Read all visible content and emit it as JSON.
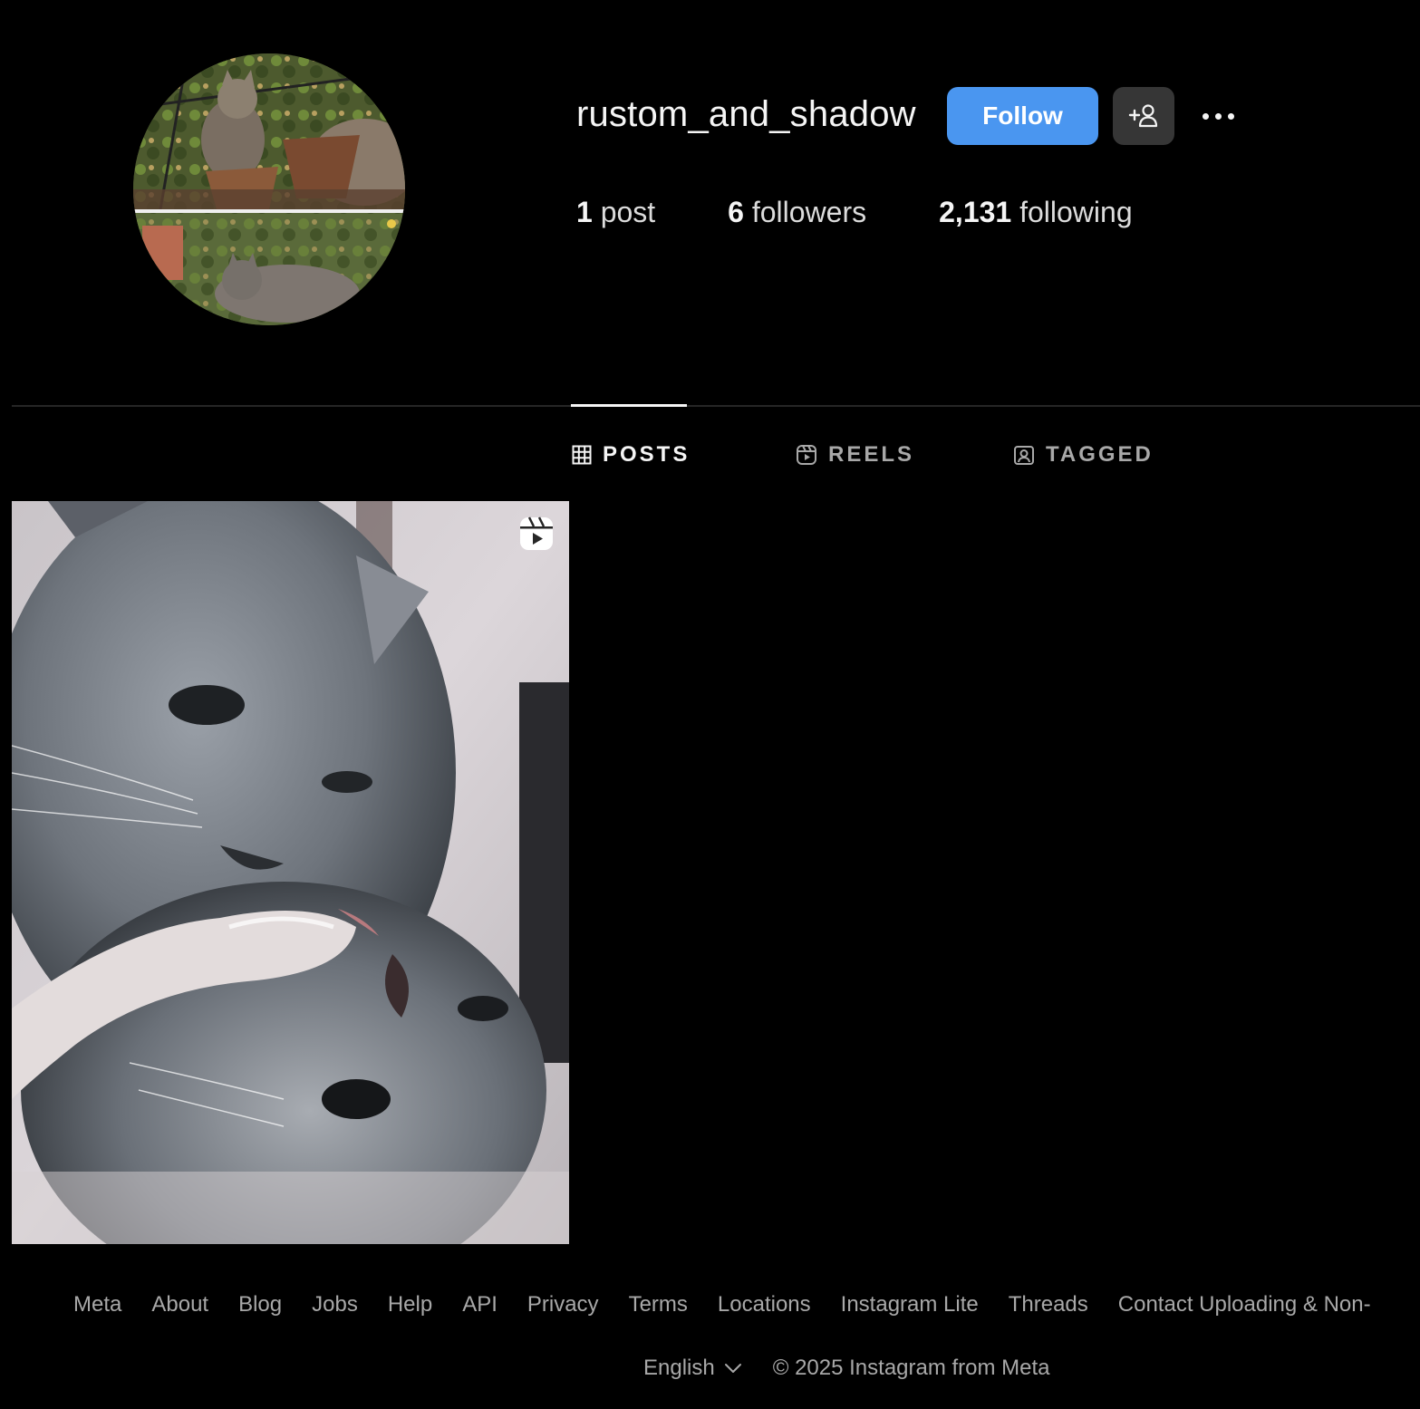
{
  "profile": {
    "username": "rustom_and_shadow",
    "follow_label": "Follow",
    "stats": {
      "posts_count": "1",
      "posts_label": "post",
      "followers_count": "6",
      "followers_label": "followers",
      "following_count": "2,131",
      "following_label": "following"
    }
  },
  "tabs": [
    {
      "label": "POSTS",
      "icon": "grid-icon",
      "active": true
    },
    {
      "label": "REELS",
      "icon": "reels-icon",
      "active": false
    },
    {
      "label": "TAGGED",
      "icon": "tagged-icon",
      "active": false
    }
  ],
  "posts": [
    {
      "type": "reel",
      "badge_icon": "reels-icon"
    }
  ],
  "footer": {
    "links": [
      "Meta",
      "About",
      "Blog",
      "Jobs",
      "Help",
      "API",
      "Privacy",
      "Terms",
      "Locations",
      "Instagram Lite",
      "Threads",
      "Contact Uploading & Non-"
    ],
    "language": "English",
    "copyright": "© 2025 Instagram from Meta"
  },
  "colors": {
    "background": "#000000",
    "follow_button": "#4a96f0",
    "secondary_button": "#363636",
    "muted_text": "#a8a8a8",
    "divider": "#262626"
  }
}
